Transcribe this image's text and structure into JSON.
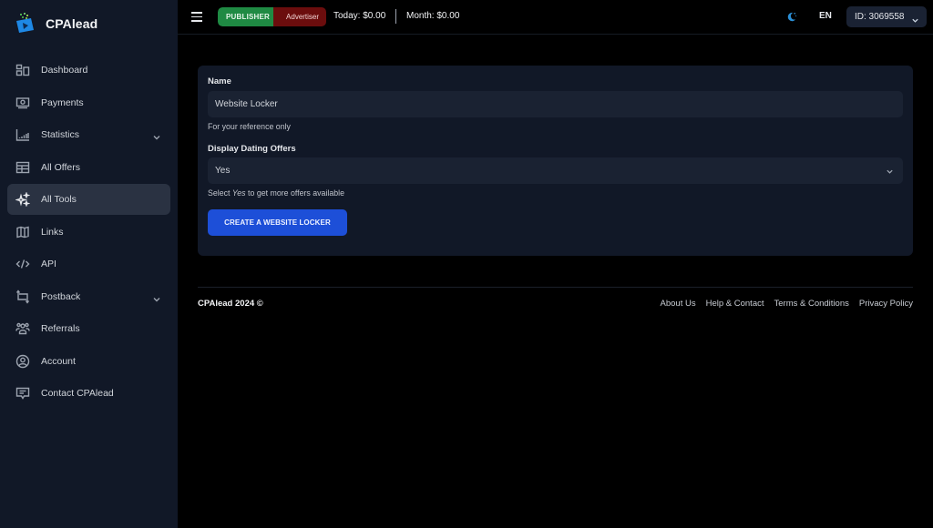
{
  "brand": {
    "name": "CPAlead",
    "logo_icon": "cpalead-logo-icon"
  },
  "sidebar": {
    "items": [
      {
        "label": "Dashboard",
        "icon": "dashboard-icon",
        "active": false,
        "has_submenu": false
      },
      {
        "label": "Payments",
        "icon": "payments-icon",
        "active": false,
        "has_submenu": false
      },
      {
        "label": "Statistics",
        "icon": "statistics-icon",
        "active": false,
        "has_submenu": true
      },
      {
        "label": "All Offers",
        "icon": "offers-table-icon",
        "active": false,
        "has_submenu": false
      },
      {
        "label": "All Tools",
        "icon": "sparkles-icon",
        "active": true,
        "has_submenu": false
      },
      {
        "label": "Links",
        "icon": "map-icon",
        "active": false,
        "has_submenu": false
      },
      {
        "label": "API",
        "icon": "code-icon",
        "active": false,
        "has_submenu": false
      },
      {
        "label": "Postback",
        "icon": "postback-icon",
        "active": false,
        "has_submenu": true
      },
      {
        "label": "Referrals",
        "icon": "users-group-icon",
        "active": false,
        "has_submenu": false
      },
      {
        "label": "Account",
        "icon": "user-circle-icon",
        "active": false,
        "has_submenu": false
      },
      {
        "label": "Contact CPAlead",
        "icon": "chat-icon",
        "active": false,
        "has_submenu": false
      }
    ]
  },
  "topbar": {
    "menu_icon": "hamburger-icon",
    "role_publisher": "PUBLISHER",
    "role_advertiser": "Advertiser",
    "today": "Today: $0.00",
    "month": "Month: $0.00",
    "theme_icon": "moon-icon",
    "language": "EN",
    "account_id": "ID: 3069558"
  },
  "form": {
    "name_label": "Name",
    "name_value": "Website Locker",
    "name_help": "For your reference only",
    "dating_label": "Display Dating Offers",
    "dating_value": "Yes",
    "dating_help_prefix": "Select ",
    "dating_help_em": "Yes",
    "dating_help_suffix": " to get more offers available",
    "submit_label": "CREATE A WEBSITE LOCKER"
  },
  "footer": {
    "copyright": "CPAlead 2024 ©",
    "links": [
      "About Us",
      "Help & Contact",
      "Terms & Conditions",
      "Privacy Policy"
    ]
  },
  "colors": {
    "publisher_green": "#1f8a43",
    "advertiser_red": "#6b0d0d",
    "primary_blue": "#1d4fd8",
    "sidebar_bg": "#111827",
    "theme_icon_blue": "#2b8fd6"
  }
}
